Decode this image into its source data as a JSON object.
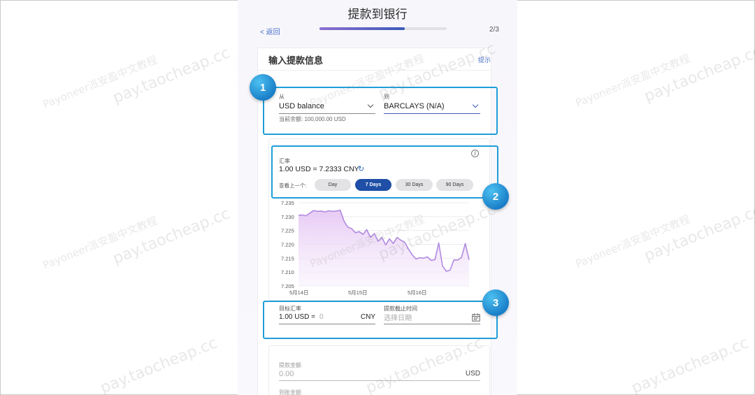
{
  "header": {
    "title": "提款到银行",
    "back_label": "< 返回",
    "step": "2/3",
    "progress": 0.67
  },
  "form": {
    "title": "输入提款信息",
    "hint_label": "提示",
    "from": {
      "label": "从",
      "value": "USD balance",
      "balance": "当前余额: 100,000.00 USD"
    },
    "to": {
      "label": "到",
      "value": "BARCLAYS (N/A)"
    }
  },
  "exchange": {
    "label": "汇率",
    "rate": "1.00 USD = 7.2333 CNY",
    "view_label": "查看上一个:",
    "ranges": [
      "Day",
      "7 Days",
      "30 Days",
      "90 Days"
    ],
    "selected_range": "7 Days",
    "info_icon": "info-icon",
    "refresh_icon": "refresh-icon"
  },
  "chart_data": {
    "type": "area",
    "y_ticks": [
      "7.235",
      "7.230",
      "7.225",
      "7.220",
      "7.215",
      "7.210",
      "7.205"
    ],
    "x_ticks": [
      "5月14日",
      "5月15日",
      "5月16日"
    ],
    "ylim": [
      7.205,
      7.235
    ],
    "grid": true,
    "color": "#b08ae0",
    "values": [
      7.2305,
      7.2306,
      7.2303,
      7.2313,
      7.2322,
      7.2319,
      7.232,
      7.2317,
      7.2321,
      7.2319,
      7.232,
      7.2323,
      7.2284,
      7.2262,
      7.2257,
      7.2242,
      7.2246,
      7.2236,
      7.2253,
      7.2225,
      7.2239,
      7.2211,
      7.2225,
      7.2198,
      7.222,
      7.2203,
      7.2225,
      7.2215,
      7.2208,
      7.2183,
      7.2162,
      7.2147,
      7.2152,
      7.215,
      7.2155,
      7.2142,
      7.2145,
      7.2205,
      7.2122,
      7.2103,
      7.2107,
      7.2144,
      7.2143,
      7.2153,
      7.2203,
      7.2144
    ]
  },
  "target": {
    "label": "目标汇率",
    "prefix": "1.00 USD =",
    "placeholder": "0",
    "currency": "CNY",
    "deadline_label": "提款截止时间",
    "date_placeholder": "选择日期",
    "calendar_icon": "calendar-icon"
  },
  "amount": {
    "withdraw_label": "提款金额",
    "withdraw_value": "0.00",
    "withdraw_currency": "USD",
    "arrive_label": "到账金额"
  },
  "badges": [
    "1",
    "2",
    "3"
  ],
  "watermark": {
    "line1": "Payoneer派安盈中文教程",
    "line2": "pay.taocheap.cc"
  }
}
